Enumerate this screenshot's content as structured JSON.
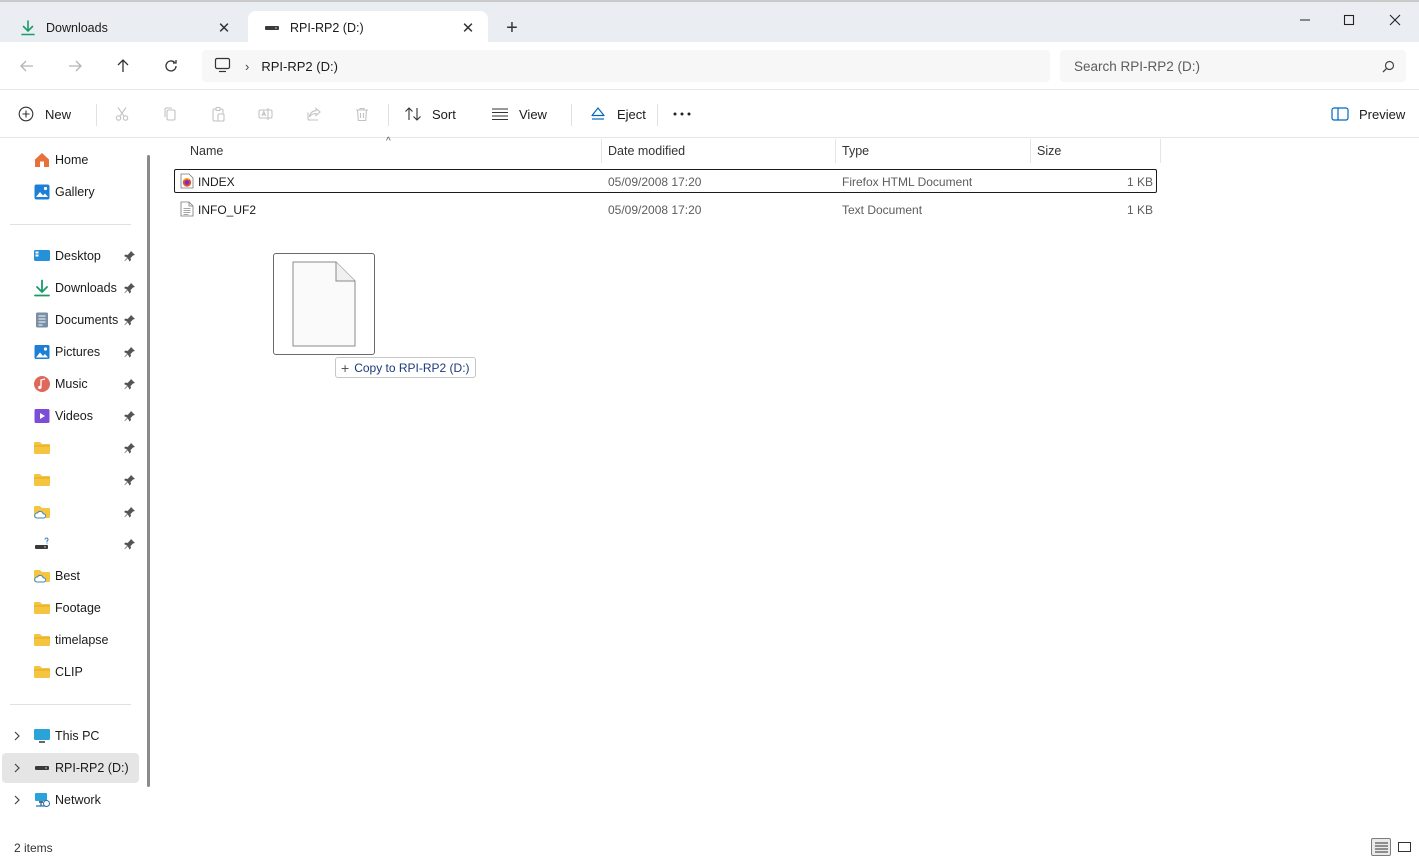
{
  "tabs": [
    {
      "label": "Downloads",
      "icon": "download-icon",
      "active": false
    },
    {
      "label": "RPI-RP2 (D:)",
      "icon": "drive-icon",
      "active": true
    }
  ],
  "address": {
    "location_icon": "this-pc-icon",
    "crumbs": [
      "RPI-RP2 (D:)"
    ],
    "search_placeholder": "Search RPI-RP2 (D:)"
  },
  "commands": {
    "new": "New",
    "sort": "Sort",
    "view": "View",
    "eject": "Eject",
    "preview": "Preview"
  },
  "sidebar": {
    "top": [
      {
        "label": "Home",
        "icon": "home-icon"
      },
      {
        "label": "Gallery",
        "icon": "gallery-icon"
      }
    ],
    "quick_access": [
      {
        "label": "Desktop",
        "icon": "desktop-icon",
        "pinned": true
      },
      {
        "label": "Downloads",
        "icon": "download-icon",
        "pinned": true
      },
      {
        "label": "Documents",
        "icon": "documents-icon",
        "pinned": true
      },
      {
        "label": "Pictures",
        "icon": "pictures-icon",
        "pinned": true
      },
      {
        "label": "Music",
        "icon": "music-icon",
        "pinned": true
      },
      {
        "label": "Videos",
        "icon": "videos-icon",
        "pinned": true
      },
      {
        "label": "",
        "icon": "folder-icon",
        "pinned": true
      },
      {
        "label": "",
        "icon": "folder-icon",
        "pinned": true
      },
      {
        "label": "",
        "icon": "cloud-folder-icon",
        "pinned": true
      },
      {
        "label": "",
        "icon": "network-drive-icon",
        "pinned": true
      },
      {
        "label": "Best",
        "icon": "cloud-folder-icon",
        "pinned": false
      },
      {
        "label": "Footage",
        "icon": "folder-icon",
        "pinned": false
      },
      {
        "label": "timelapse",
        "icon": "folder-icon",
        "pinned": false
      },
      {
        "label": "CLIP",
        "icon": "folder-icon",
        "pinned": false
      }
    ],
    "locations": [
      {
        "label": "This PC",
        "icon": "this-pc-icon",
        "selected": false
      },
      {
        "label": "RPI-RP2 (D:)",
        "icon": "drive-icon",
        "selected": true
      },
      {
        "label": "Network",
        "icon": "network-icon",
        "selected": false
      }
    ]
  },
  "columns": {
    "name": "Name",
    "date": "Date modified",
    "type": "Type",
    "size": "Size"
  },
  "files": [
    {
      "name": "INDEX",
      "date": "05/09/2008 17:20",
      "type": "Firefox HTML Document",
      "size": "1 KB",
      "icon": "firefox-html-icon"
    },
    {
      "name": "INFO_UF2",
      "date": "05/09/2008 17:20",
      "type": "Text Document",
      "size": "1 KB",
      "icon": "text-document-icon"
    }
  ],
  "drag": {
    "tooltip": "Copy to RPI-RP2 (D:)"
  },
  "status": {
    "count": "2 items"
  },
  "colors": {
    "accent": "#0067c0",
    "folder": "#f5c542",
    "tabbar": "#eaeef3",
    "selection": "#e5e5e5"
  }
}
